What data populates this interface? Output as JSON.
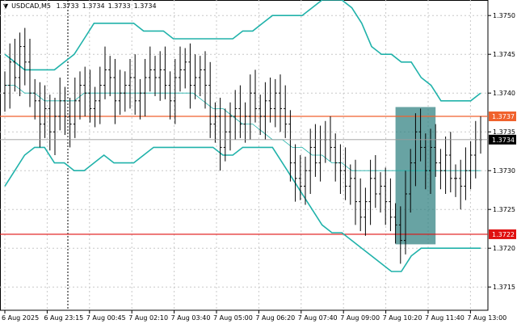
{
  "header": {
    "symbol_timeframe": "USDCAD,M5",
    "ohlc": [
      "1.3733",
      "1.3734",
      "1.3733",
      "1.3734"
    ]
  },
  "chart_data": {
    "type": "candlestick",
    "symbol": "USDCAD",
    "timeframe": "M5",
    "ylim": [
      1.3712,
      1.3752
    ],
    "y_ticks": [
      "1.3750",
      "1.3745",
      "1.3740",
      "1.3735",
      "1.3730",
      "1.3725",
      "1.3720",
      "1.3715"
    ],
    "x_ticks": [
      "6 Aug 2025",
      "6 Aug 23:15",
      "7 Aug 00:45",
      "7 Aug 02:10",
      "7 Aug 03:40",
      "7 Aug 05:00",
      "7 Aug 06:20",
      "7 Aug 07:40",
      "7 Aug 09:00",
      "7 Aug 10:20",
      "7 Aug 11:40",
      "7 Aug 13:00"
    ],
    "current_price": {
      "label": "1.3734",
      "value": 1.3734
    },
    "levels": [
      {
        "label": "1.3737",
        "value": 1.3737,
        "color": "#f0622d"
      },
      {
        "label": "1.3722",
        "value": 1.37218,
        "color": "#e01010"
      }
    ],
    "highlight_zone": {
      "from_bar": 78,
      "to_bar": 86,
      "top": 1.37382,
      "bottom": 1.37205,
      "color": "#2e8080"
    },
    "closes": [
      1.3741,
      1.3744,
      1.3742,
      1.3746,
      1.3744,
      1.374,
      1.3739,
      1.3736,
      1.3738,
      1.3735,
      1.3737,
      1.3739,
      1.3737,
      1.3736,
      1.3739,
      1.3741,
      1.374,
      1.3738,
      1.3739,
      1.3741,
      1.3743,
      1.3742,
      1.3739,
      1.374,
      1.3741,
      1.3742,
      1.3739,
      1.374,
      1.3742,
      1.3743,
      1.3742,
      1.3743,
      1.3741,
      1.3739,
      1.3742,
      1.3743,
      1.3744,
      1.3741,
      1.3742,
      1.3743,
      1.3741,
      1.3736,
      1.3737,
      1.3733,
      1.3735,
      1.3737,
      1.3738,
      1.3736,
      1.3737,
      1.374,
      1.3738,
      1.3737,
      1.3739,
      1.3738,
      1.374,
      1.3738,
      1.3736,
      1.3731,
      1.3729,
      1.3728,
      1.373,
      1.3733,
      1.3731,
      1.3734,
      1.3734,
      1.3733,
      1.3731,
      1.373,
      1.3728,
      1.3729,
      1.3726,
      1.3724,
      1.3726,
      1.3729,
      1.3727,
      1.3728,
      1.3726,
      1.3724,
      1.3723,
      1.3721,
      1.3727,
      1.3731,
      1.3735,
      1.3733,
      1.373,
      1.3733,
      1.3731,
      1.373,
      1.3732,
      1.3729,
      1.3729,
      1.3728,
      1.373,
      1.3732,
      1.3734,
      1.3734
    ],
    "bollinger": {
      "upper": [
        1.3745,
        1.3744,
        1.3743,
        1.3743,
        1.3743,
        1.3743,
        1.3744,
        1.3745,
        1.3747,
        1.3749,
        1.3749,
        1.3749,
        1.3749,
        1.3749,
        1.3748,
        1.3748,
        1.3748,
        1.3747,
        1.3747,
        1.3747,
        1.3747,
        1.3747,
        1.3747,
        1.3747,
        1.3748,
        1.3748,
        1.3749,
        1.375,
        1.375,
        1.375,
        1.375,
        1.3751,
        1.3752,
        1.3752,
        1.3752,
        1.3751,
        1.3749,
        1.3746,
        1.3745,
        1.3745,
        1.3744,
        1.3744,
        1.3742,
        1.3741,
        1.3739,
        1.3739,
        1.3739,
        1.3739,
        1.374
      ],
      "middle": [
        1.3741,
        1.3741,
        1.374,
        1.374,
        1.3739,
        1.3739,
        1.3739,
        1.3739,
        1.374,
        1.374,
        1.374,
        1.374,
        1.374,
        1.374,
        1.374,
        1.374,
        1.374,
        1.374,
        1.374,
        1.374,
        1.3739,
        1.3738,
        1.3738,
        1.3737,
        1.3736,
        1.3736,
        1.3735,
        1.3734,
        1.3734,
        1.3733,
        1.3733,
        1.3732,
        1.3732,
        1.3731,
        1.3731,
        1.373,
        1.373,
        1.373,
        1.373,
        1.373,
        1.373,
        1.373,
        1.373,
        1.373,
        1.373,
        1.373,
        1.373,
        1.373,
        1.373
      ],
      "lower": [
        1.3728,
        1.373,
        1.3732,
        1.3733,
        1.3733,
        1.3731,
        1.3731,
        1.373,
        1.373,
        1.3731,
        1.3732,
        1.3731,
        1.3731,
        1.3731,
        1.3732,
        1.3733,
        1.3733,
        1.3733,
        1.3733,
        1.3733,
        1.3733,
        1.3733,
        1.3732,
        1.3732,
        1.3733,
        1.3733,
        1.3733,
        1.3733,
        1.3731,
        1.3729,
        1.3727,
        1.3725,
        1.3723,
        1.3722,
        1.3722,
        1.3721,
        1.372,
        1.3719,
        1.3718,
        1.3717,
        1.3717,
        1.3719,
        1.372,
        1.372,
        1.372,
        1.372,
        1.372,
        1.372,
        1.372
      ]
    }
  },
  "colors": {
    "candle": "#000000",
    "band": "#20b2aa",
    "grid": "#c8c8c8",
    "price_tag_bg": "#000000",
    "cursor": "#000000"
  }
}
